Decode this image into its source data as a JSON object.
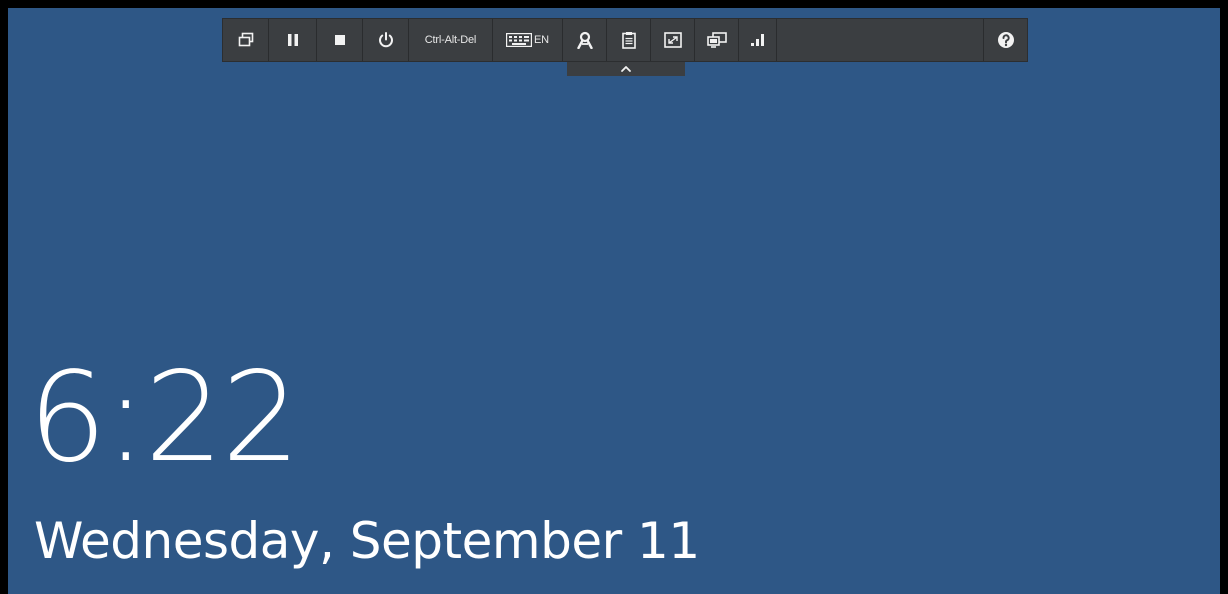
{
  "toolbar": {
    "ctrl_alt_del_label": "Ctrl-Alt-Del",
    "keyboard_language": "EN",
    "icons": [
      "restore-window-icon",
      "pause-icon",
      "stop-icon",
      "power-icon",
      "keyboard-icon",
      "user-icon",
      "clipboard-icon",
      "fullscreen-icon",
      "multi-monitor-icon",
      "signal-strength-icon",
      "help-icon"
    ]
  },
  "tab_handle": {
    "icon": "chevron-up-icon"
  },
  "lockscreen": {
    "time": "6:22",
    "date": "Wednesday, September 11"
  },
  "colors": {
    "desktop_background": "#2e5786",
    "toolbar_background": "#3b3e41",
    "text": "#ffffff"
  }
}
